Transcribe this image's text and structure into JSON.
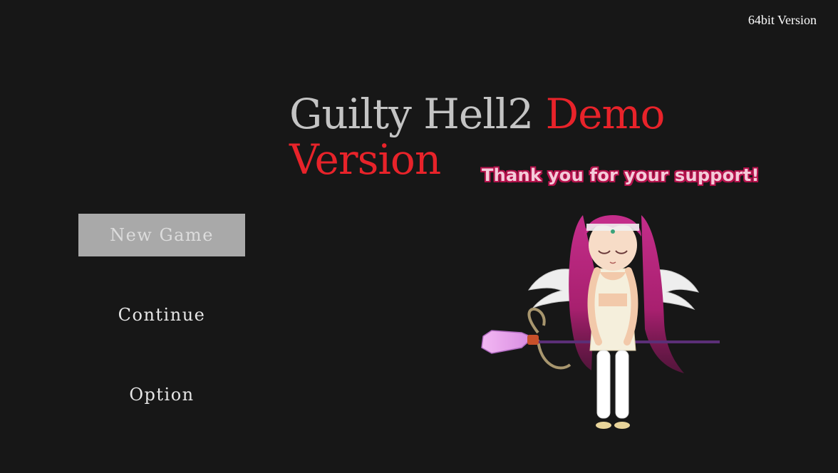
{
  "header": {
    "version_label": "64bit Version"
  },
  "title": {
    "part1": "Guilty Hell2 ",
    "part2": "Demo Version"
  },
  "menu": {
    "items": [
      {
        "label": "New Game",
        "selected": true
      },
      {
        "label": "Continue",
        "selected": false
      },
      {
        "label": "Option",
        "selected": false
      }
    ]
  },
  "character": {
    "message": "Thank you for your support!",
    "icon": "angel-girl-with-staff"
  },
  "colors": {
    "background": "#171717",
    "title_gray": "#c4c4c4",
    "title_red": "#e8232a",
    "selected_button": "#a9a9a9",
    "message_fill": "#f4cbd9",
    "message_outline": "#b5124c"
  }
}
